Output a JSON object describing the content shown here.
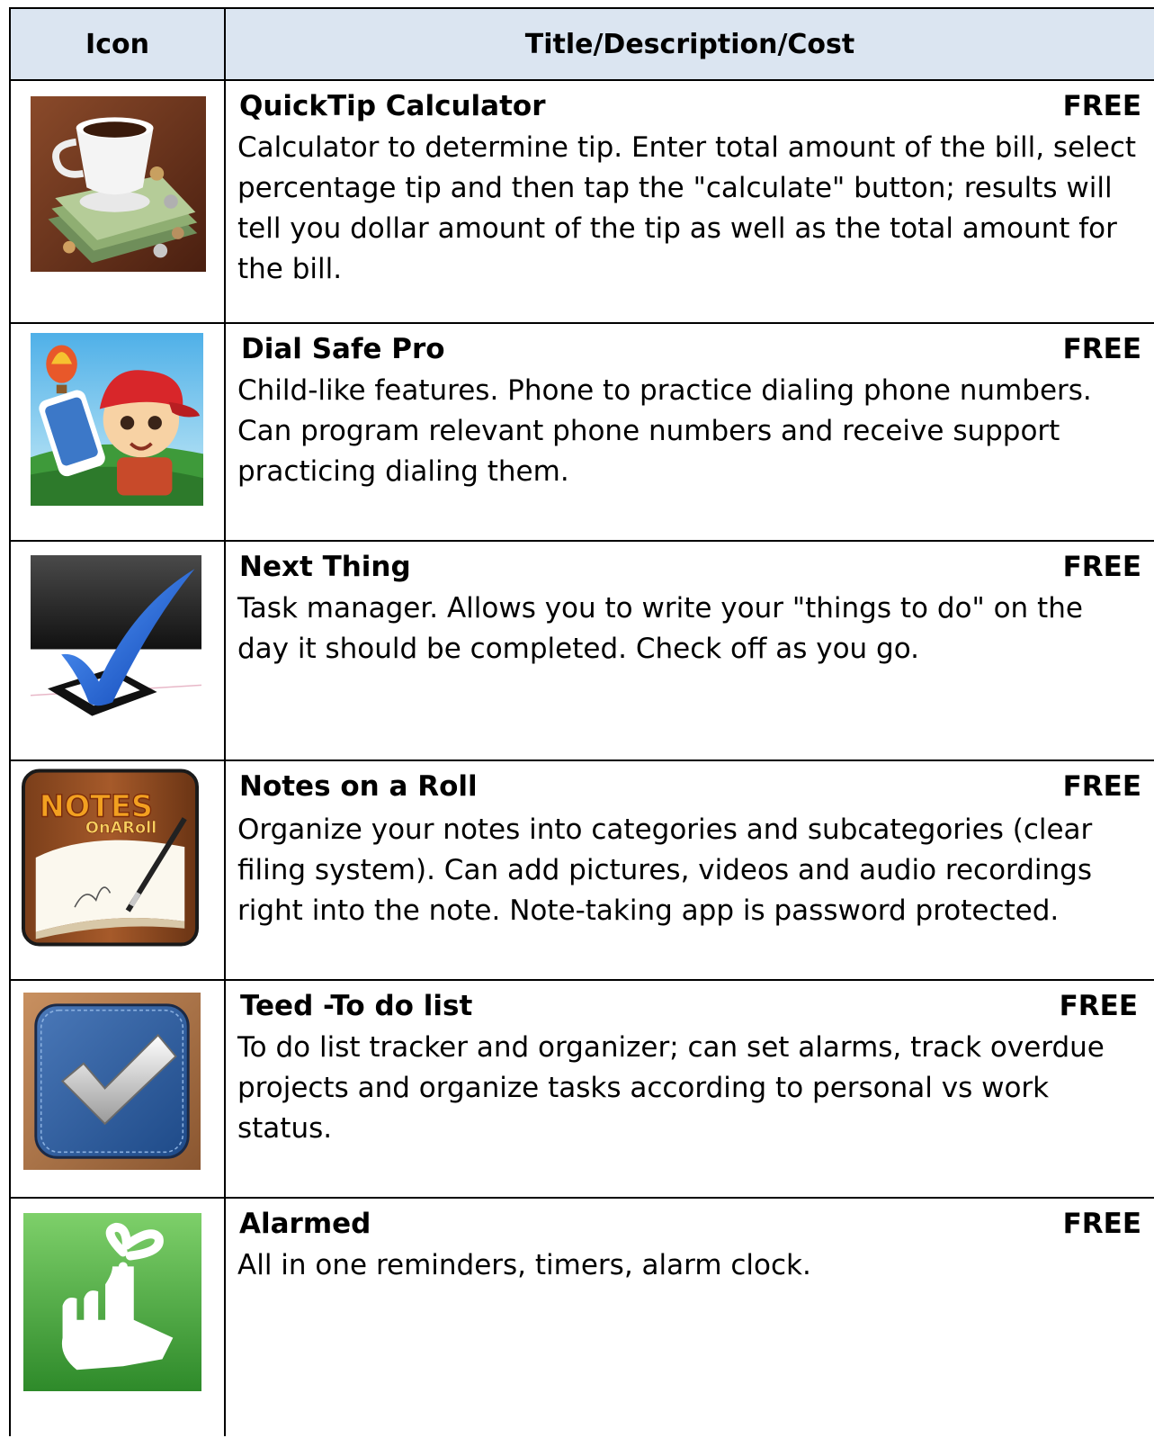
{
  "header": {
    "icon_col": "Icon",
    "title_col": "Title/Description/Cost"
  },
  "apps": [
    {
      "title": "QuickTip Calculator",
      "cost": "FREE",
      "description": "Calculator to determine tip.  Enter total amount of the bill, select percentage tip and then tap the \"calculate\" button; results will tell you dollar amount of the tip as well as the total amount for the bill.",
      "icon": "coffee-cup-money-icon"
    },
    {
      "title": "Dial Safe Pro",
      "cost": "FREE",
      "description": "Child-like features.  Phone to practice dialing phone numbers.  Can program relevant phone numbers and receive support practicing dialing them.",
      "icon": "child-phone-icon"
    },
    {
      "title": "Next Thing",
      "cost": "FREE",
      "description": "Task manager.  Allows you to write your \"things to do\" on the day it should be completed.  Check off as you go.",
      "icon": "blue-checkmark-icon"
    },
    {
      "title": "Notes on a Roll",
      "cost": "FREE",
      "description": "Organize your notes into categories and subcategories (clear filing system).  Can add pictures, videos and audio recordings right into the note.   Note-taking app is password protected.",
      "icon": "notes-pen-icon",
      "icon_text_1": "NOTES",
      "icon_text_2": "OnARoll"
    },
    {
      "title": "Teed -To do list",
      "cost": "FREE",
      "description": "To do list tracker and organizer; can set alarms, track overdue projects and organize tasks according to personal vs work status.",
      "icon": "denim-checkmark-icon"
    },
    {
      "title": "Alarmed",
      "cost": "FREE",
      "description": "All in one reminders, timers, alarm clock.",
      "icon": "finger-ribbon-icon"
    }
  ],
  "colors": {
    "header_bg": "#dbe5f1",
    "border": "#000000"
  }
}
